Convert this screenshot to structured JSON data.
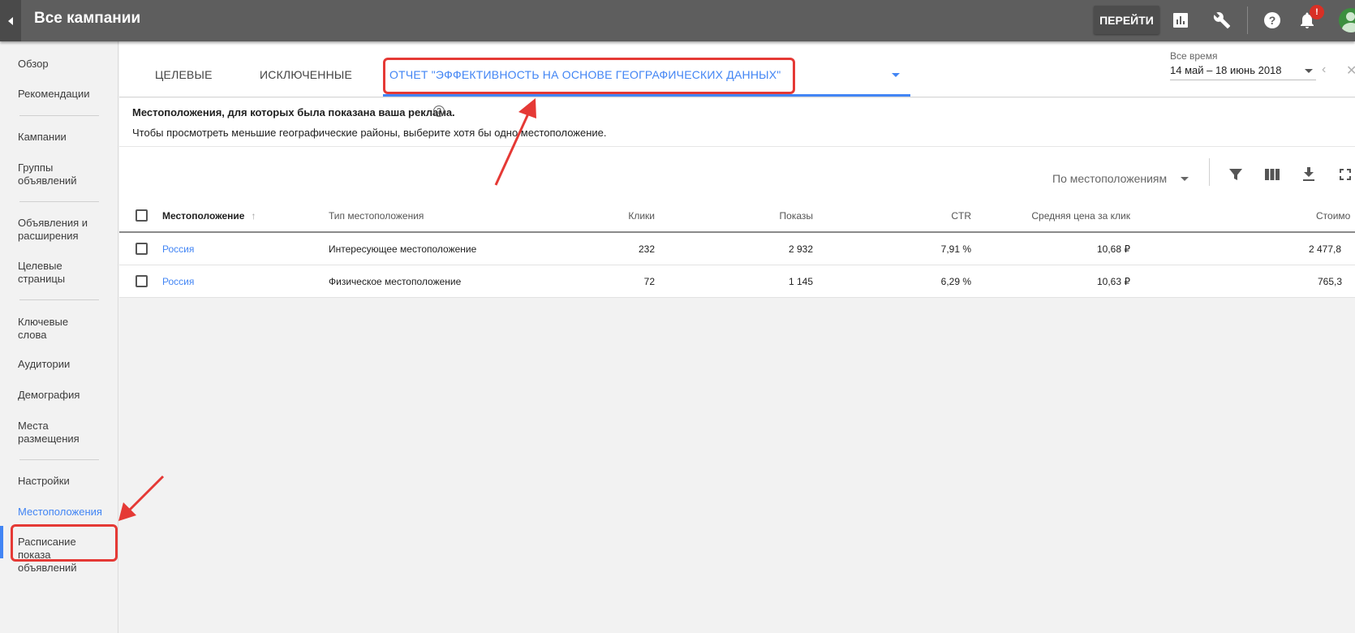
{
  "header": {
    "title": "Все кампании",
    "goto_label": "ПЕРЕЙТИ",
    "notification_badge": "!"
  },
  "sidebar": {
    "items": [
      {
        "label": "Обзор"
      },
      {
        "label": "Рекомендации"
      },
      {
        "label": "Кампании"
      },
      {
        "label": "Группы объявлений"
      },
      {
        "label": "Объявления и расширения"
      },
      {
        "label": "Целевые страницы"
      },
      {
        "label": "Ключевые слова"
      },
      {
        "label": "Аудитории"
      },
      {
        "label": "Демография"
      },
      {
        "label": "Места размещения"
      },
      {
        "label": "Настройки"
      },
      {
        "label": "Местоположения"
      },
      {
        "label": "Расписание показа объявлений"
      }
    ]
  },
  "tabs": [
    {
      "label": "ЦЕЛЕВЫЕ"
    },
    {
      "label": "ИСКЛЮЧЕННЫЕ"
    },
    {
      "label": "ОТЧЕТ \"ЭФФЕКТИВНОСТЬ НА ОСНОВЕ ГЕОГРАФИЧЕСКИХ ДАННЫХ\""
    }
  ],
  "date": {
    "label": "Все время",
    "range": "14 май – 18 июнь 2018"
  },
  "info": {
    "title": "Местоположения, для которых была показана ваша реклама.",
    "subtitle": "Чтобы просмотреть меньшие географические районы, выберите хотя бы одно местоположение."
  },
  "toolbar": {
    "group_by": "По местоположениям"
  },
  "table": {
    "columns": [
      "Местоположение",
      "Тип местоположения",
      "Клики",
      "Показы",
      "CTR",
      "Средняя цена за клик",
      "Стоимо"
    ],
    "rows": [
      {
        "location": "Россия",
        "type": "Интересующее местоположение",
        "clicks": "232",
        "impressions": "2 932",
        "ctr": "7,91 %",
        "cpc": "10,68 ₽",
        "cost": "2 477,8"
      },
      {
        "location": "Россия",
        "type": "Физическое местоположение",
        "clicks": "72",
        "impressions": "1 145",
        "ctr": "6,29 %",
        "cpc": "10,63 ₽",
        "cost": "765,3"
      }
    ]
  },
  "colors": {
    "topbar": "#5e5e5e",
    "accent": "#4285f4",
    "annotation": "#e53935"
  }
}
